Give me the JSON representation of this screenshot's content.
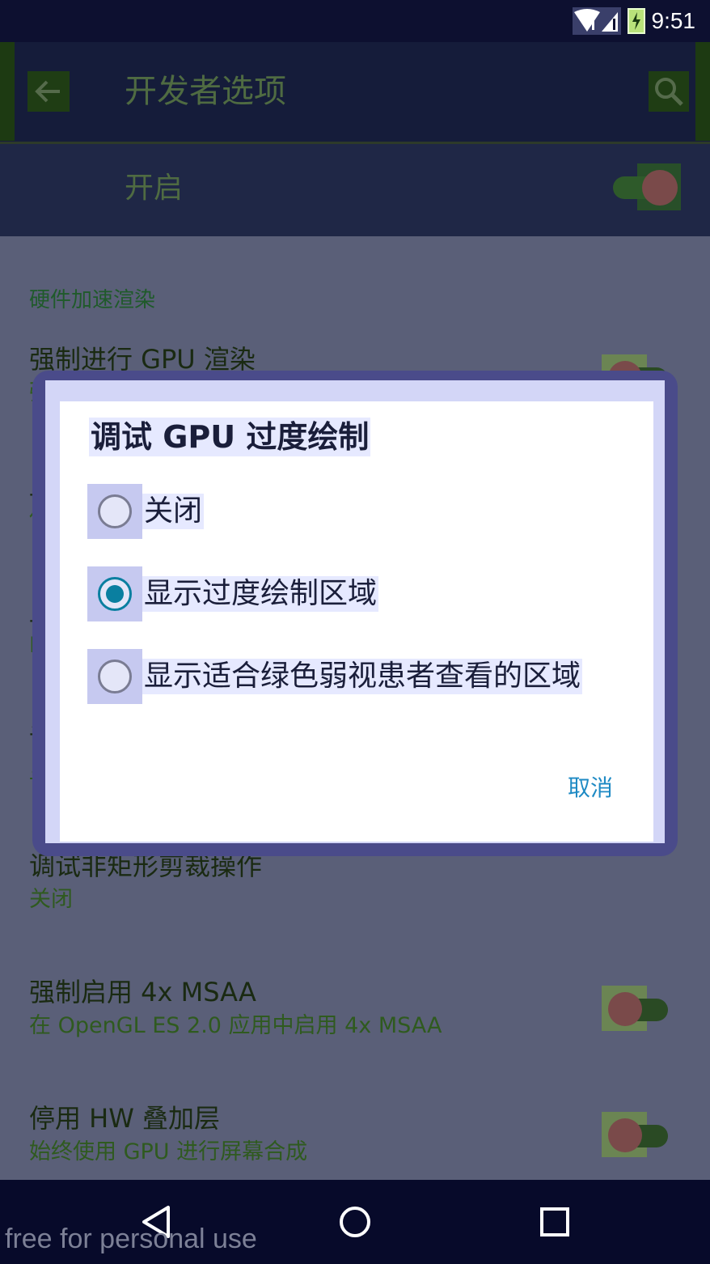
{
  "status_bar": {
    "time": "9:51",
    "icons": [
      "wifi-icon",
      "signal-icon",
      "battery-charging-icon"
    ]
  },
  "app_bar": {
    "back_icon": "arrow-back-icon",
    "title": "开发者选项",
    "search_icon": "search-icon"
  },
  "master_switch": {
    "label": "开启",
    "state": "on"
  },
  "section": {
    "header": "硬件加速渲染"
  },
  "prefs": [
    {
      "title": "强制进行 GPU 渲染",
      "subtitle": "强"
    },
    {
      "title": "显",
      "subtitle": "使"
    },
    {
      "title": "显",
      "subtitle": "Fl"
    },
    {
      "title": "调",
      "subtitle": "显"
    },
    {
      "title": "调试非矩形剪裁操作",
      "subtitle": "关闭"
    },
    {
      "title": "强制启用 4x MSAA",
      "subtitle": "在 OpenGL ES 2.0 应用中启用 4x MSAA"
    },
    {
      "title": "停用 HW 叠加层",
      "subtitle": "始终使用 GPU 进行屏幕合成"
    }
  ],
  "dialog": {
    "title": "调试 GPU 过度绘制",
    "options": [
      {
        "label": "关闭",
        "selected": false
      },
      {
        "label": "显示过度绘制区域",
        "selected": true
      },
      {
        "label": "显示适合绿色弱视患者查看的区域",
        "selected": false
      }
    ],
    "cancel": "取消"
  },
  "nav_bar": {
    "buttons": [
      "back-triangle-icon",
      "home-circle-icon",
      "recents-square-icon"
    ]
  },
  "watermark": "free for personal use",
  "colors": {
    "accent": "#0a7fa0",
    "cancel_text": "#1e8ac4",
    "scrim": "#5a5f78"
  }
}
